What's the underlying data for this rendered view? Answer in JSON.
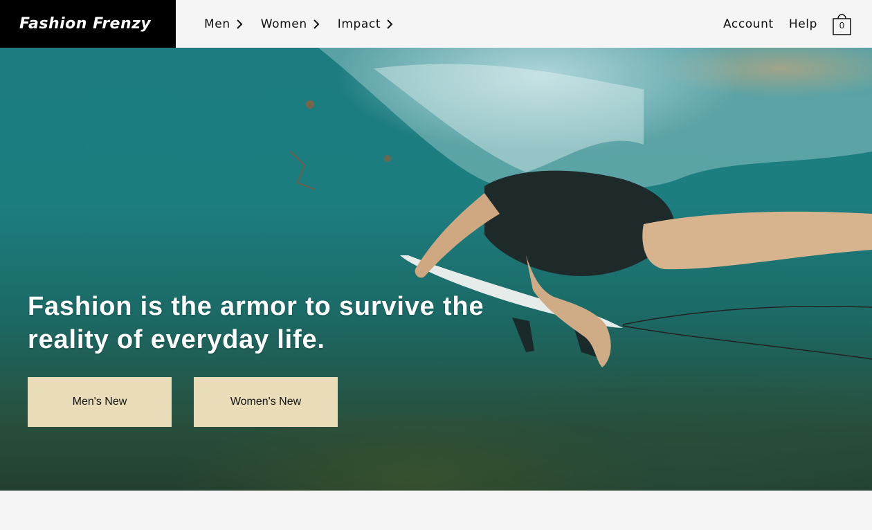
{
  "brand": {
    "name": "Fashion Frenzy"
  },
  "nav": {
    "items": [
      {
        "label": "Men",
        "icon": "chevron-right-icon"
      },
      {
        "label": "Women",
        "icon": "chevron-right-icon"
      },
      {
        "label": "Impact",
        "icon": "chevron-right-icon"
      }
    ]
  },
  "header_links": {
    "account": "Account",
    "help": "Help",
    "cart_count": "0",
    "cart_icon": "shopping-bag-icon"
  },
  "hero": {
    "headline": "Fashion is the armor to survive the reality of everyday life.",
    "buttons": {
      "mens": "Men's New",
      "womens": "Women's New"
    },
    "button_color": "#e8ddb8"
  }
}
